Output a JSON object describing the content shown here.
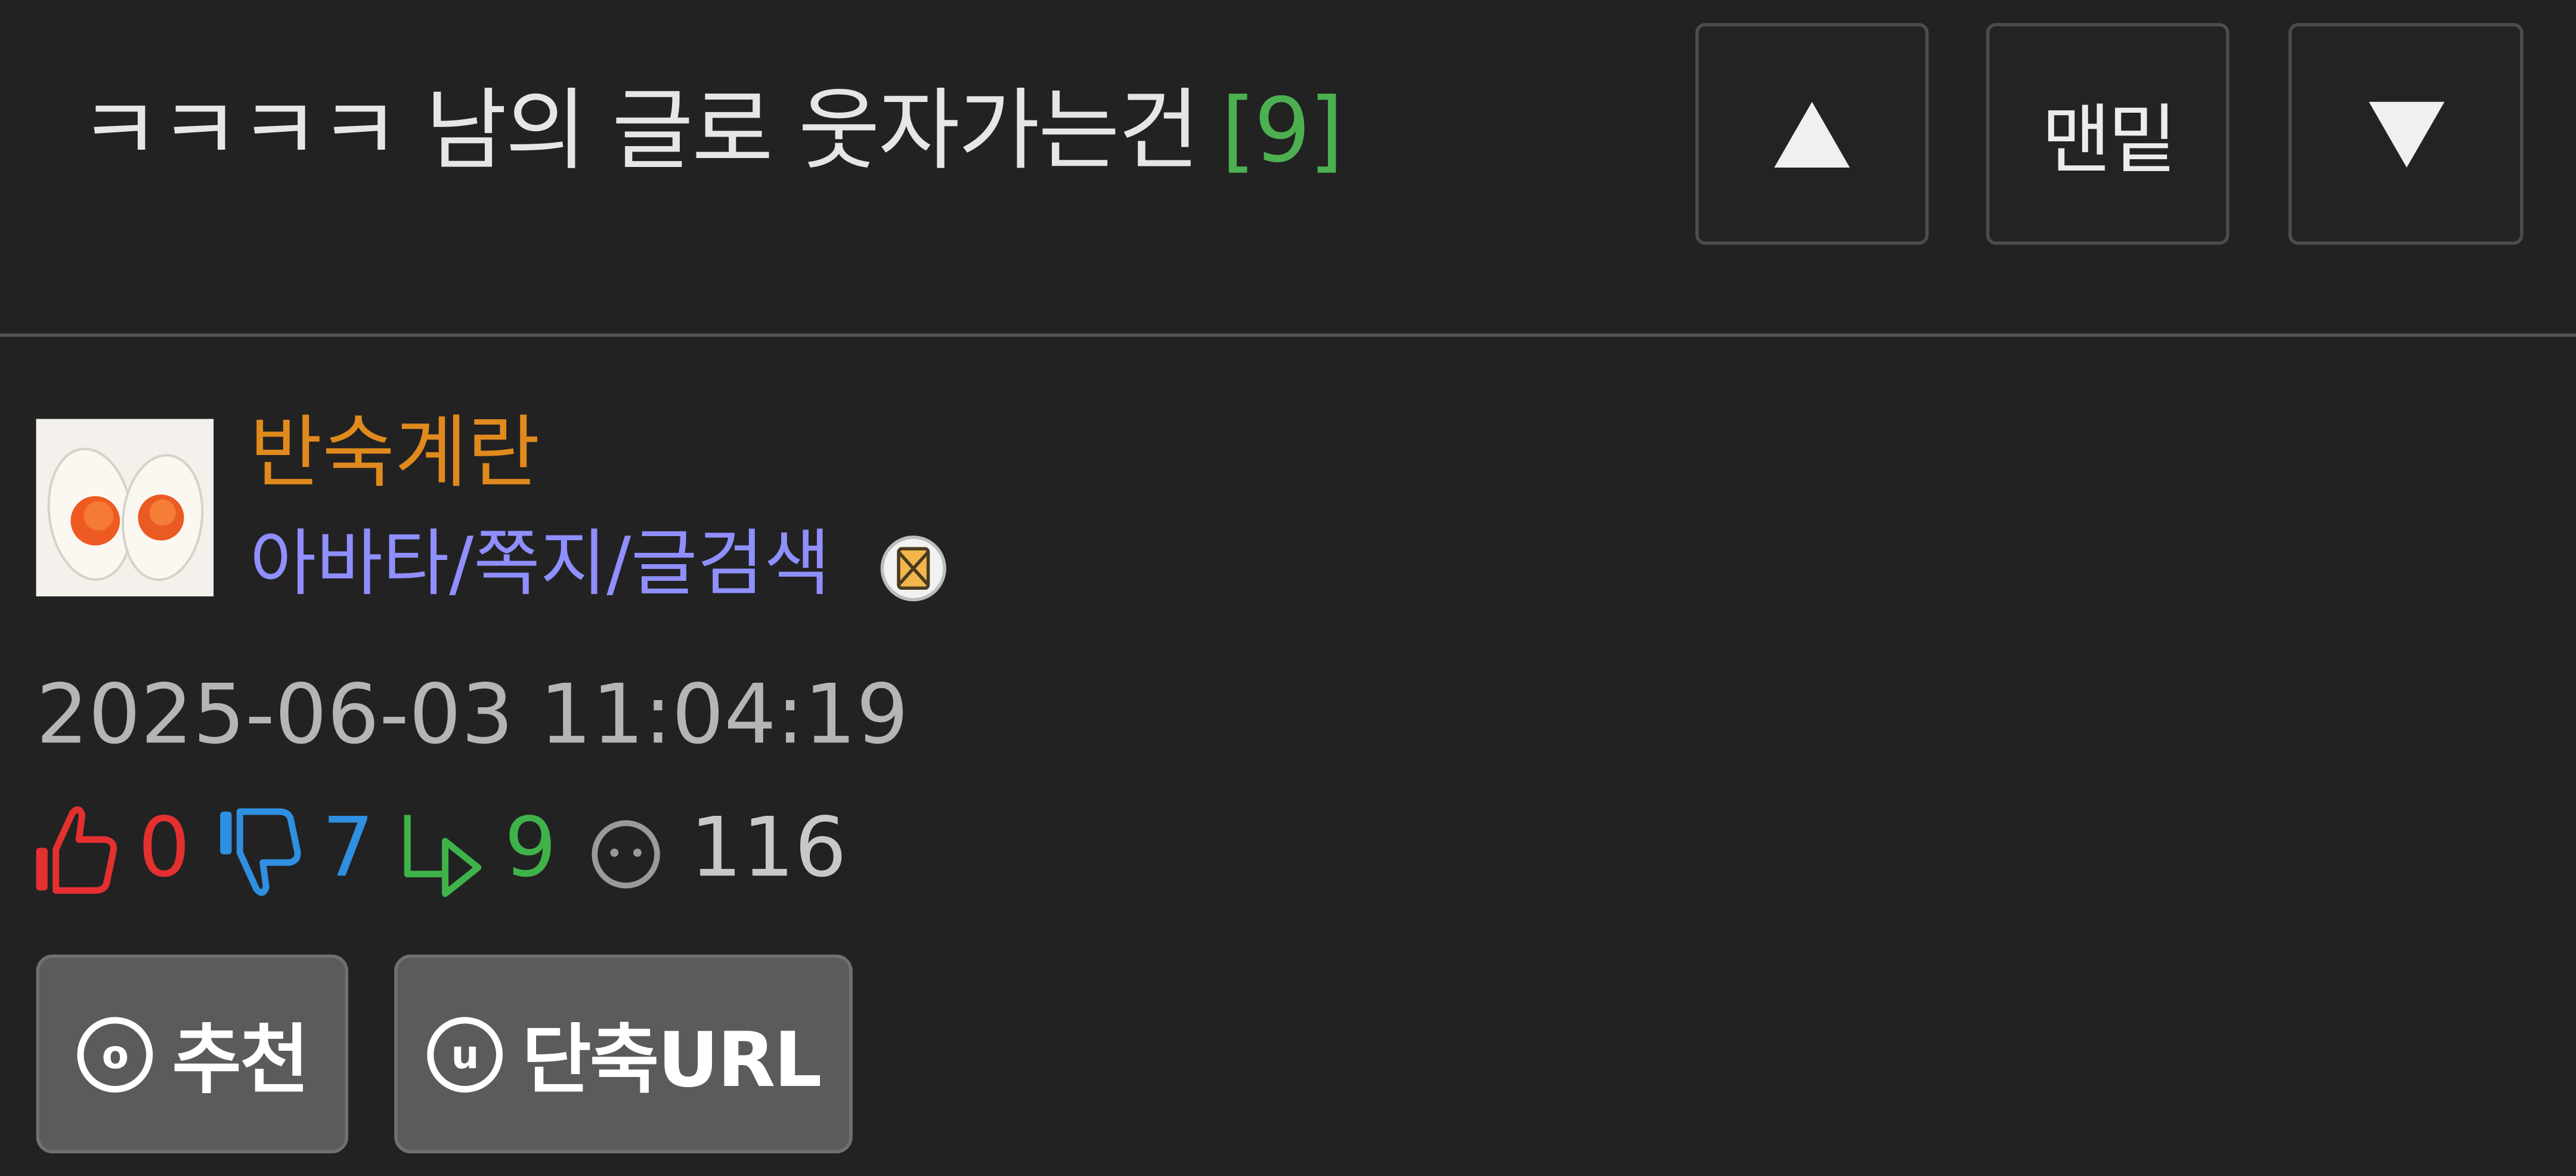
{
  "header": {
    "title": "ㅋㅋㅋㅋ 남의 글로 웃자가는건",
    "comment_count": "[9]",
    "nav": {
      "up_icon": "triangle-up-icon",
      "bottom_label": "맨밑",
      "down_icon": "triangle-down-icon"
    }
  },
  "author": {
    "name": "반숙계란",
    "links": "아바타/쪽지/글검색",
    "avatar_icon": "boiled-egg-avatar",
    "badge_icon": "level-badge-icon"
  },
  "post": {
    "datetime": "2025-06-03 11:04:19"
  },
  "stats": {
    "upvotes": "0",
    "downvotes": "7",
    "replies": "9",
    "views": "116"
  },
  "actions": {
    "recommend_label": "추천",
    "recommend_icon_char": "o",
    "short_url_label": "단축URL",
    "short_url_icon_char": "u"
  },
  "colors": {
    "background": "#222222",
    "title_count": "#4caf50",
    "author_name": "#e08a1e",
    "author_links": "#8f8fff",
    "upvote": "#e53030",
    "downvote": "#2f8fe0",
    "reply": "#3fb24a",
    "views": "#9a9a9a"
  }
}
